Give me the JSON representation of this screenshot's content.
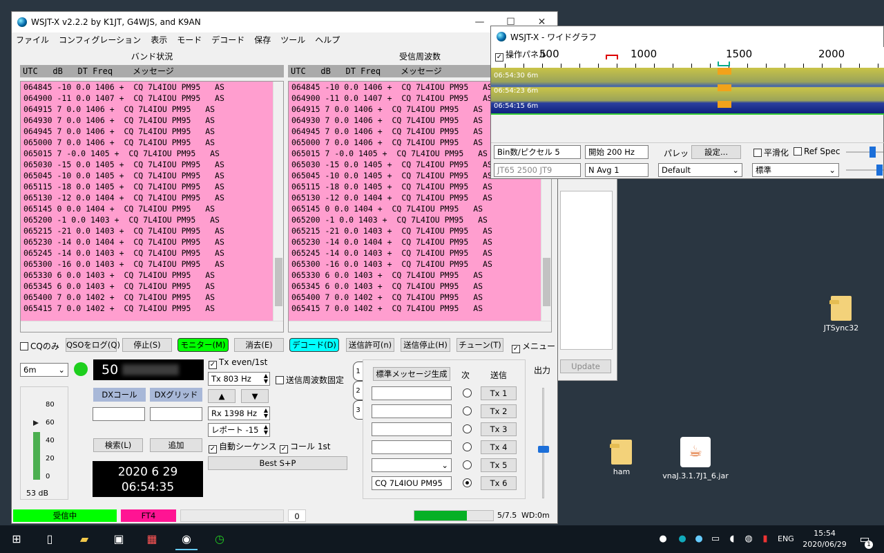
{
  "desktop": {
    "icons": [
      {
        "label": "JTSync32"
      },
      {
        "label": "ham"
      },
      {
        "label": "vnaJ.3.1.7J1_6.jar"
      }
    ]
  },
  "main": {
    "title": "WSJT-X   v2.2.2   by K1JT, G4WJS, and K9AN",
    "menu": [
      "ファイル",
      "コンフィグレーション",
      "表示",
      "モード",
      "デコード",
      "保存",
      "ツール",
      "ヘルプ"
    ],
    "band_title": "バンド状況",
    "rx_title": "受信周波数",
    "header": "UTC   dB   DT Freq    メッセージ",
    "rows": [
      {
        "utc": "064845",
        "db": "-10",
        "dt": "0.0",
        "freq": "1406",
        "msg": "+  CQ 7L4IOU PM95",
        "tail": "AS"
      },
      {
        "utc": "064900",
        "db": "-11",
        "dt": "0.0",
        "freq": "1407",
        "msg": "+  CQ 7L4IOU PM95",
        "tail": "AS"
      },
      {
        "utc": "064915",
        "db": "7",
        "dt": "0.0",
        "freq": "1406",
        "msg": "+  CQ 7L4IOU PM95",
        "tail": "AS"
      },
      {
        "utc": "064930",
        "db": "7",
        "dt": "0.0",
        "freq": "1406",
        "msg": "+  CQ 7L4IOU PM95",
        "tail": "AS"
      },
      {
        "utc": "064945",
        "db": "7",
        "dt": "0.0",
        "freq": "1406",
        "msg": "+  CQ 7L4IOU PM95",
        "tail": "AS"
      },
      {
        "utc": "065000",
        "db": "7",
        "dt": "0.0",
        "freq": "1406",
        "msg": "+  CQ 7L4IOU PM95",
        "tail": "AS"
      },
      {
        "utc": "065015",
        "db": "7",
        "dt": "-0.0",
        "freq": "1405",
        "msg": "+  CQ 7L4IOU PM95",
        "tail": "AS"
      },
      {
        "utc": "065030",
        "db": "-15",
        "dt": "0.0",
        "freq": "1405",
        "msg": "+  CQ 7L4IOU PM95",
        "tail": "AS"
      },
      {
        "utc": "065045",
        "db": "-10",
        "dt": "0.0",
        "freq": "1405",
        "msg": "+  CQ 7L4IOU PM95",
        "tail": "AS"
      },
      {
        "utc": "065115",
        "db": "-18",
        "dt": "0.0",
        "freq": "1405",
        "msg": "+  CQ 7L4IOU PM95",
        "tail": "AS"
      },
      {
        "utc": "065130",
        "db": "-12",
        "dt": "0.0",
        "freq": "1404",
        "msg": "+  CQ 7L4IOU PM95",
        "tail": "AS"
      },
      {
        "utc": "065145",
        "db": "0",
        "dt": "0.0",
        "freq": "1404",
        "msg": "+  CQ 7L4IOU PM95",
        "tail": "AS"
      },
      {
        "utc": "065200",
        "db": "-1",
        "dt": "0.0",
        "freq": "1403",
        "msg": "+  CQ 7L4IOU PM95",
        "tail": "AS"
      },
      {
        "utc": "065215",
        "db": "-21",
        "dt": "0.0",
        "freq": "1403",
        "msg": "+  CQ 7L4IOU PM95",
        "tail": "AS"
      },
      {
        "utc": "065230",
        "db": "-14",
        "dt": "0.0",
        "freq": "1404",
        "msg": "+  CQ 7L4IOU PM95",
        "tail": "AS"
      },
      {
        "utc": "065245",
        "db": "-14",
        "dt": "0.0",
        "freq": "1403",
        "msg": "+  CQ 7L4IOU PM95",
        "tail": "AS"
      },
      {
        "utc": "065300",
        "db": "-16",
        "dt": "0.0",
        "freq": "1403",
        "msg": "+  CQ 7L4IOU PM95",
        "tail": "AS"
      },
      {
        "utc": "065330",
        "db": "6",
        "dt": "0.0",
        "freq": "1403",
        "msg": "+  CQ 7L4IOU PM95",
        "tail": "AS"
      },
      {
        "utc": "065345",
        "db": "6",
        "dt": "0.0",
        "freq": "1403",
        "msg": "+  CQ 7L4IOU PM95",
        "tail": "AS"
      },
      {
        "utc": "065400",
        "db": "7",
        "dt": "0.0",
        "freq": "1402",
        "msg": "+  CQ 7L4IOU PM95",
        "tail": "AS"
      },
      {
        "utc": "065415",
        "db": "7",
        "dt": "0.0",
        "freq": "1402",
        "msg": "+  CQ 7L4IOU PM95",
        "tail": "AS"
      }
    ],
    "controls": {
      "cq_only": "CQのみ",
      "log_qso": "QSOをログ(Q)",
      "stop": "停止(S)",
      "monitor": "モニター(M)",
      "erase": "消去(E)",
      "decode": "デコード(D)",
      "enable_tx": "送信許可(n)",
      "halt_tx": "送信停止(H)",
      "tune": "チューン(T)",
      "menus": "メニュー"
    },
    "band": "6m",
    "freq_display": "50",
    "tx_even": "Tx even/1st",
    "tx_freq": "Tx  803  Hz",
    "hold_tx_freq": "送信周波数固定",
    "rx_freq": "Rx  1398  Hz",
    "report": "レポート -15",
    "auto_seq": "自動シーケンス",
    "call_1st": "コール 1st",
    "best_sp": "Best S+P",
    "dx_call_label": "DXコール",
    "dx_grid_label": "DXグリッド",
    "lookup": "検索(L)",
    "add": "追加",
    "date": "2020 6 29",
    "time": "06:54:35",
    "meter_ticks": [
      "80",
      "60",
      "40",
      "20",
      "0"
    ],
    "meter_level_db": "53 dB",
    "meter_level_value": 53,
    "gen_std_msgs": "標準メッセージ生成",
    "next_label": "次",
    "send_label": "送信",
    "tx_buttons": [
      "Tx 1",
      "Tx 2",
      "Tx 3",
      "Tx 4",
      "Tx 5",
      "Tx 6"
    ],
    "tx6_msg": "CQ 7L4IOU PM95",
    "output_label": "出力",
    "status_rx": "受信中",
    "status_mode": "FT4",
    "status_zero": "0",
    "status_progress": "5/7.5",
    "status_progress_value": 0.6667,
    "status_wd": "WD:0m",
    "tab_labels": [
      "1",
      "2",
      "3"
    ]
  },
  "wide": {
    "title": "WSJT-X - ワイドグラフ",
    "control_panel": "操作パネル",
    "scale": [
      "500",
      "1000",
      "1500",
      "2000"
    ],
    "wf_labels": [
      {
        "time": "06:54:30",
        "band": "6m"
      },
      {
        "time": "06:54:23",
        "band": "6m"
      },
      {
        "time": "06:54:15",
        "band": "6m"
      }
    ],
    "bins": "Bin数/ピクセル  5",
    "start": "開始  200 Hz",
    "palette": "パレット",
    "settings": "設定...",
    "smooth": "平滑化",
    "ref_spec": "Ref Spec",
    "jt": "JT65  2500  JT9",
    "navg": "N Avg  1",
    "default": "Default",
    "standard": "標準"
  },
  "hidden_panel": {
    "update": "Update"
  },
  "taskbar": {
    "lang": "ENG",
    "time": "15:54",
    "date": "2020/06/29",
    "notify": "1"
  }
}
